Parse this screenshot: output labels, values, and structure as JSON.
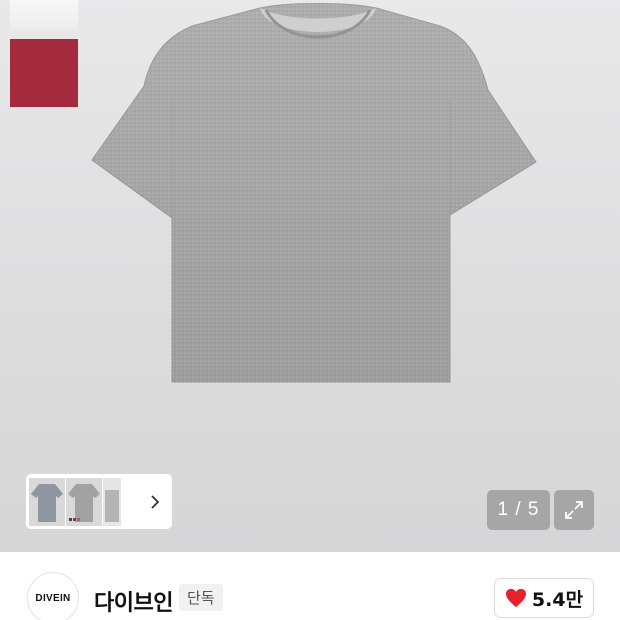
{
  "gallery": {
    "current_page": "1 / 5",
    "colors": {
      "background": "#dcdcdd",
      "shirt": "#a9a9a9",
      "swatch_red": "#a42a3e"
    }
  },
  "brand": {
    "logo_text": "DIVEIN",
    "name": "다이브인",
    "badge": "단독"
  },
  "like": {
    "count": "5.4만",
    "color": "#e8212f"
  }
}
